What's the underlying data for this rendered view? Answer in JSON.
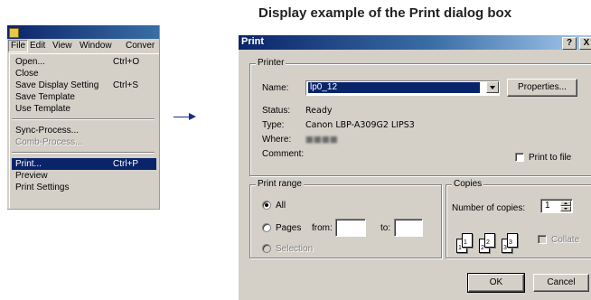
{
  "caption": "Display example of the Print dialog box",
  "left_menu": {
    "menubar": [
      "File",
      "Edit",
      "View",
      "Window",
      "Conver"
    ],
    "items": [
      {
        "label": "Open...",
        "shortcut": "Ctrl+O",
        "state": "normal"
      },
      {
        "label": "Close",
        "shortcut": "",
        "state": "normal"
      },
      {
        "label": "Save Display Setting",
        "shortcut": "Ctrl+S",
        "state": "normal"
      },
      {
        "label": "Save Template",
        "shortcut": "",
        "state": "normal"
      },
      {
        "label": "Use Template",
        "shortcut": "",
        "state": "normal"
      },
      {
        "label": "Sync-Process...",
        "shortcut": "",
        "state": "normal"
      },
      {
        "label": "Comb-Process...",
        "shortcut": "",
        "state": "disabled"
      },
      {
        "label": "Print...",
        "shortcut": "Ctrl+P",
        "state": "selected"
      },
      {
        "label": "Preview",
        "shortcut": "",
        "state": "normal"
      },
      {
        "label": "Print Settings",
        "shortcut": "",
        "state": "normal"
      }
    ]
  },
  "dialog": {
    "title": "Print",
    "titlebar_buttons": [
      "?",
      "X"
    ],
    "printer": {
      "legend": "Printer",
      "name_label": "Name:",
      "name_value": "lp0_12",
      "properties_button": "Properties...",
      "status_label": "Status:",
      "status_value": "Ready",
      "type_label": "Type:",
      "type_value": "Canon LBP-A309G2 LIPS3",
      "where_label": "Where:",
      "where_value": "■■■■",
      "comment_label": "Comment:",
      "print_to_file_label": "Print to file"
    },
    "print_range": {
      "legend": "Print range",
      "all_label": "All",
      "pages_label": "Pages",
      "from_label": "from:",
      "to_label": "to:",
      "selection_label": "Selection"
    },
    "copies": {
      "legend": "Copies",
      "number_label": "Number of copies:",
      "number_value": "1",
      "pages": [
        "1",
        "1",
        "2",
        "2",
        "3",
        "3"
      ],
      "collate_label": "Collate"
    },
    "ok_button": "OK",
    "cancel_button": "Cancel"
  }
}
